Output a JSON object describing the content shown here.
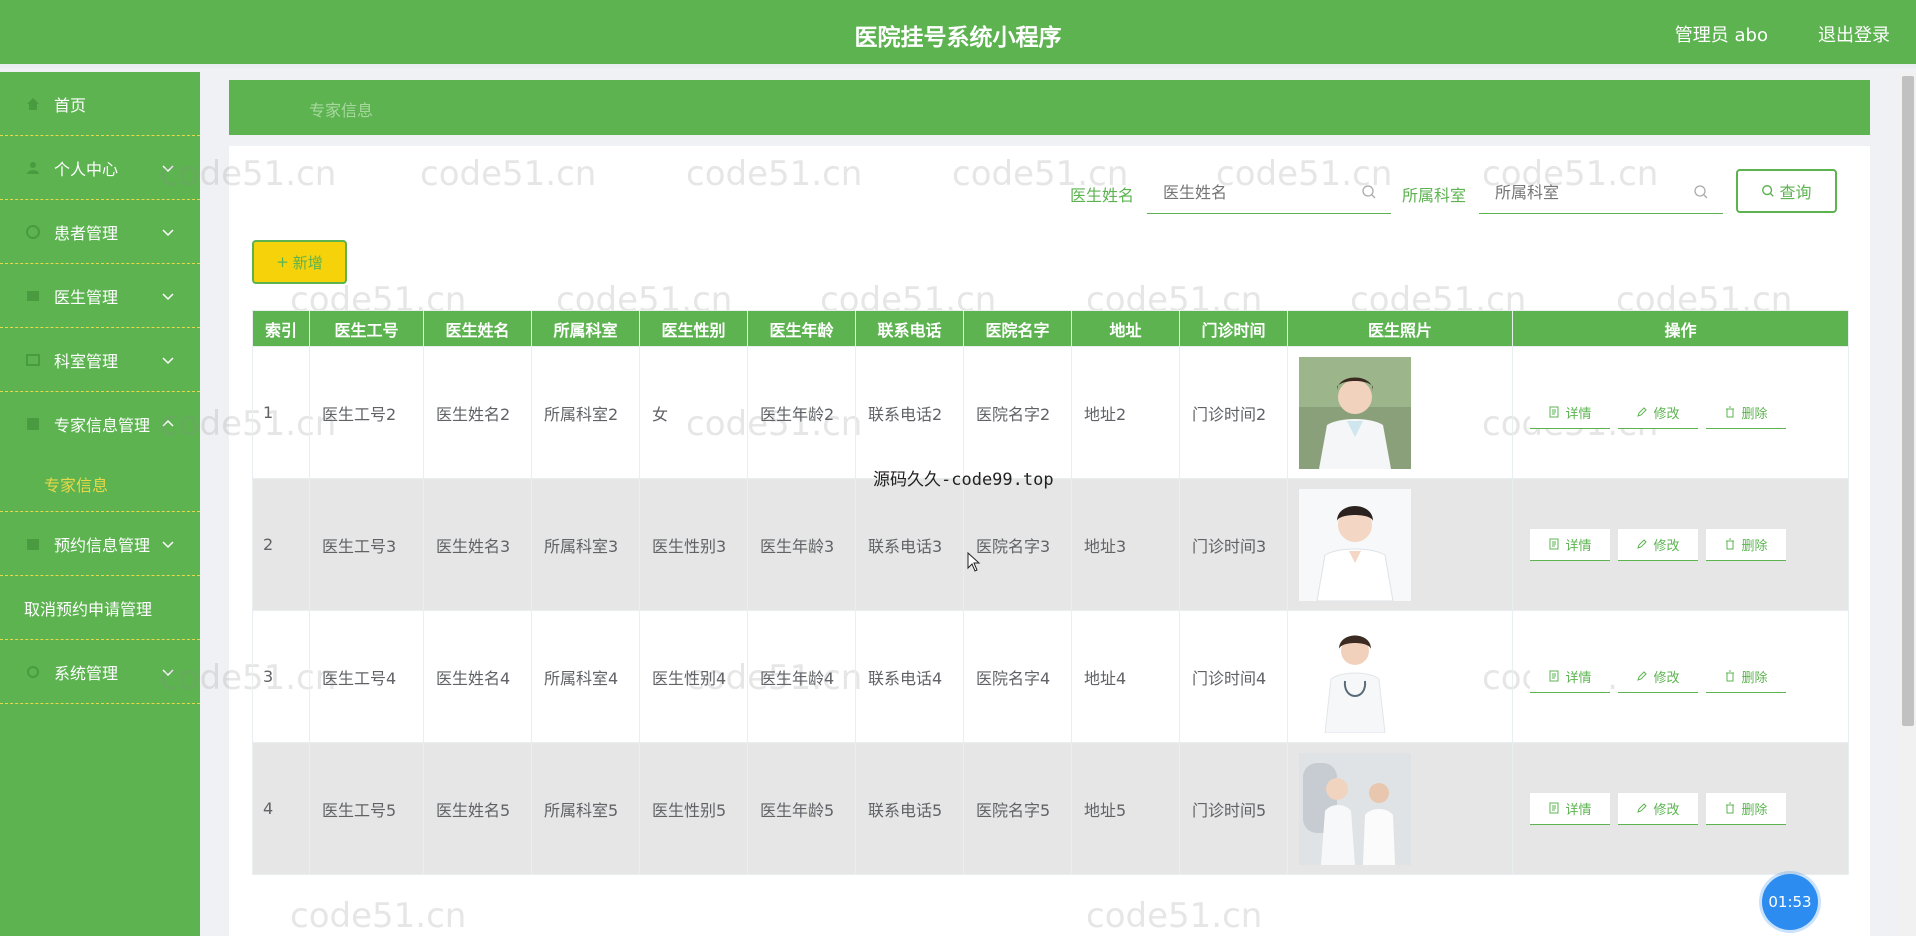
{
  "header": {
    "title": "医院挂号系统小程序",
    "user_label": "管理员 abo",
    "logout_label": "退出登录"
  },
  "sidebar": {
    "items": [
      {
        "label": "首页",
        "icon": "home-icon",
        "has_children": false
      },
      {
        "label": "个人中心",
        "icon": "user-icon",
        "has_children": true
      },
      {
        "label": "患者管理",
        "icon": "patient-icon",
        "has_children": true
      },
      {
        "label": "医生管理",
        "icon": "doctor-icon",
        "has_children": true
      },
      {
        "label": "科室管理",
        "icon": "department-icon",
        "has_children": true
      },
      {
        "label": "专家信息管理",
        "icon": "expert-icon",
        "has_children": true,
        "expanded": true,
        "children": [
          "专家信息"
        ]
      },
      {
        "label": "预约信息管理",
        "icon": "appointment-icon",
        "has_children": true
      },
      {
        "label": "取消预约申请管理",
        "icon": "cancel-icon",
        "has_children": false
      },
      {
        "label": "系统管理",
        "icon": "system-icon",
        "has_children": true
      }
    ]
  },
  "breadcrumb": {
    "current": "专家信息"
  },
  "search": {
    "doctor_name_label": "医生姓名",
    "doctor_name_placeholder": "医生姓名",
    "department_label": "所属科室",
    "department_placeholder": "所属科室",
    "query_label": "查询"
  },
  "toolbar": {
    "add_label": "新增"
  },
  "table": {
    "headers": [
      "索引",
      "医生工号",
      "医生姓名",
      "所属科室",
      "医生性别",
      "医生年龄",
      "联系电话",
      "医院名字",
      "地址",
      "门诊时间",
      "医生照片",
      "操作"
    ],
    "rows": [
      [
        "1",
        "医生工号2",
        "医生姓名2",
        "所属科室2",
        "女",
        "医生年龄2",
        "联系电话2",
        "医院名字2",
        "地址2",
        "门诊时间2"
      ],
      [
        "2",
        "医生工号3",
        "医生姓名3",
        "所属科室3",
        "医生性别3",
        "医生年龄3",
        "联系电话3",
        "医院名字3",
        "地址3",
        "门诊时间3"
      ],
      [
        "3",
        "医生工号4",
        "医生姓名4",
        "所属科室4",
        "医生性别4",
        "医生年龄4",
        "联系电话4",
        "医院名字4",
        "地址4",
        "门诊时间4"
      ],
      [
        "4",
        "医生工号5",
        "医生姓名5",
        "所属科室5",
        "医生性别5",
        "医生年龄5",
        "联系电话5",
        "医院名字5",
        "地址5",
        "门诊时间5"
      ]
    ],
    "actions": {
      "detail": "详情",
      "edit": "修改",
      "delete": "删除"
    }
  },
  "watermark": "code51.cn",
  "overlay_text": "源码久久-code99.top",
  "timer": "01:53",
  "colors": {
    "primary": "#5cb350",
    "accent": "#f5d20a",
    "timer": "#2d8cf0"
  }
}
